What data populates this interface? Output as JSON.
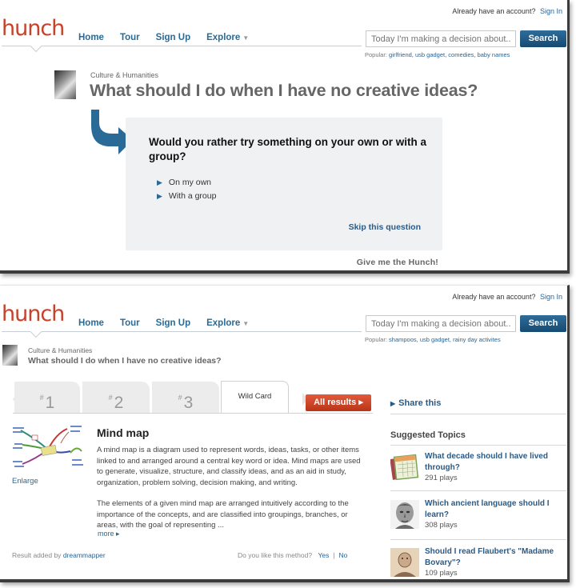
{
  "screen1": {
    "account_prompt": "Already have an account?",
    "sign_in": "Sign In",
    "logo": "hunch",
    "nav": [
      "Home",
      "Tour",
      "Sign Up",
      "Explore"
    ],
    "search_placeholder": "Today I'm making a decision about...",
    "search_button": "Search",
    "popular_label": "Popular:",
    "popular_links": [
      "girlfriend,",
      "usb gadget,",
      "comedies,",
      "baby names"
    ],
    "category": "Culture & Humanities",
    "question": "What should I do when I have no creative ideas?",
    "prompt": "Would you rather try something on your own or with a group?",
    "answers": [
      "On my own",
      "With a group"
    ],
    "skip": "Skip this question",
    "give_hunch": "Give me the Hunch!"
  },
  "screen2": {
    "account_prompt": "Already have an account?",
    "sign_in": "Sign In",
    "logo": "hunch",
    "nav": [
      "Home",
      "Tour",
      "Sign Up",
      "Explore"
    ],
    "search_placeholder": "Today I'm making a decision about...",
    "search_button": "Search",
    "popular_label": "Popular:",
    "popular_links": [
      "shampoos,",
      "usb gadget,",
      "rainy day activites"
    ],
    "category": "Culture & Humanities",
    "question": "What should I do when I have no creative ideas?",
    "tabs": [
      {
        "hash": "#",
        "num": "1"
      },
      {
        "hash": "#",
        "num": "2"
      },
      {
        "hash": "#",
        "num": "3"
      }
    ],
    "wild_tab": "Wild Card",
    "all_results": "All results ▸",
    "share": "Share this",
    "suggested_title": "Suggested Topics",
    "suggested": [
      {
        "title": "What decade should I have lived through?",
        "plays": "291 plays",
        "icon": "calendar-icon"
      },
      {
        "title": "Which ancient language should I learn?",
        "plays": "308 plays",
        "icon": "statue-icon"
      },
      {
        "title": "Should I read Flaubert's \"Madame Bovary\"?",
        "plays": "109 plays",
        "icon": "portrait-icon"
      }
    ],
    "result": {
      "title": "Mind map",
      "enlarge": "Enlarge",
      "desc1": "A mind map is a diagram used to represent words, ideas, tasks, or other items linked to and arranged around a central key word or idea. Mind maps are used to generate, visualize, structure, and classify ideas, and as an aid in study, organization, problem solving, decision making, and writing.",
      "desc2": "The elements of a given mind map are arranged intuitively according to the importance of the concepts, and are classified into groupings, branches, or areas, with the goal of representing ...",
      "more": "more ▸",
      "added_by_label": "Result added by",
      "added_by_user": "dreammapper",
      "like_prompt": "Do you like this method?",
      "yes": "Yes",
      "sep": "|",
      "no": "No"
    }
  }
}
